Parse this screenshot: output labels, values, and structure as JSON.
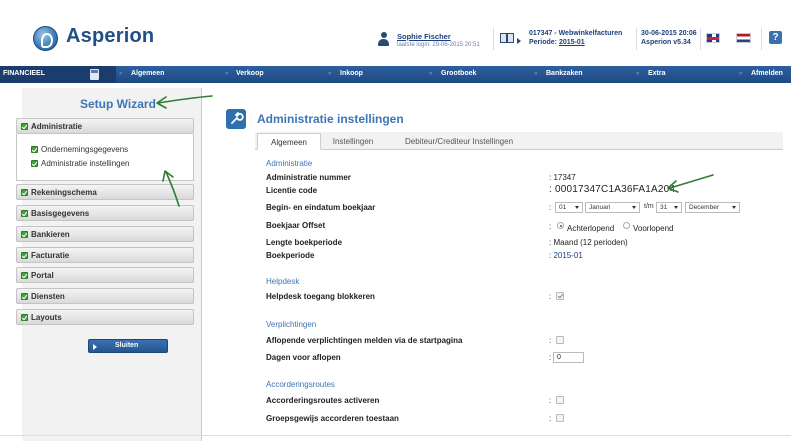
{
  "app": {
    "name": "Asperion"
  },
  "user": {
    "name": "Sophie Fischer",
    "last_login": "laatste login: 29-06-2015 20:51"
  },
  "administration": {
    "line1": "017347 - Webwinkelfacturen",
    "period_label": "Periode:",
    "period_value": "2015-01"
  },
  "datetime": {
    "line1": "30-06-2015 20:06",
    "line2": "Asperion v5.34"
  },
  "header_icons": [
    "user-icon",
    "administration-icon",
    "flag-uk-icon",
    "flag-nl-icon",
    "help-icon"
  ],
  "help_glyph": "?",
  "nav": {
    "section": "FINANCIEEL",
    "items": [
      "Algemeen",
      "Verkoop",
      "Inkoop",
      "Grootboek",
      "Bankzaken",
      "Extra",
      "Afmelden"
    ]
  },
  "wizard": {
    "title": "Setup Wizard",
    "sections": [
      {
        "label": "Administratie",
        "checked": true,
        "expanded": true,
        "items": [
          "Ondernemingsgegevens",
          "Administratie instellingen"
        ]
      },
      {
        "label": "Rekeningschema",
        "checked": true
      },
      {
        "label": "Basisgegevens",
        "checked": true
      },
      {
        "label": "Bankieren",
        "checked": true
      },
      {
        "label": "Facturatie",
        "checked": true
      },
      {
        "label": "Portal",
        "checked": true
      },
      {
        "label": "Diensten",
        "checked": true
      },
      {
        "label": "Layouts",
        "checked": true
      }
    ],
    "close_button": "Sluiten"
  },
  "main": {
    "title": "Administratie instellingen",
    "tabs": [
      "Algemeen",
      "Instellingen",
      "Debiteur/Crediteur Instellingen"
    ],
    "active_tab": 0,
    "sections": {
      "administratie": "Administratie",
      "helpdesk": "Helpdesk",
      "verplichtingen": "Verplichtingen",
      "accorderingsroutes": "Accorderingsroutes"
    },
    "fields": {
      "admin_number_label": "Administratie nummer",
      "admin_number_value": ": 17347",
      "license_label": "Licentie code",
      "license_value": ": 00017347C1A36FA1A204",
      "year_label": "Begin- en eindatum boekjaar",
      "year_start_day": "01",
      "year_start_month": "Januari",
      "year_separator": "t/m",
      "year_end_day": "31",
      "year_end_month": "December",
      "offset_label": "Boekjaar Offset",
      "offset_option1": "Achterlopend",
      "offset_option2": "Voorlopend",
      "offset_selected": "Achterlopend",
      "period_length_label": "Lengte boekperiode",
      "period_length_value": ": Maand (12 perioden)",
      "period_label": "Boekperiode",
      "period_value": ": 2015-01",
      "helpdesk_label": "Helpdesk toegang blokkeren",
      "helpdesk_checked": true,
      "verpl_startpage_label": "Aflopende verplichtingen melden via de startpagina",
      "verpl_startpage_checked": false,
      "verpl_days_label": "Dagen voor aflopen",
      "verpl_days_value": "0",
      "accord_activate_label": "Accorderingsroutes activeren",
      "accord_activate_checked": false,
      "accord_group_label": "Groepsgewijs accorderen toestaan",
      "accord_group_checked": false,
      "colon": ":"
    }
  },
  "annotation_color": "#2e7d32"
}
